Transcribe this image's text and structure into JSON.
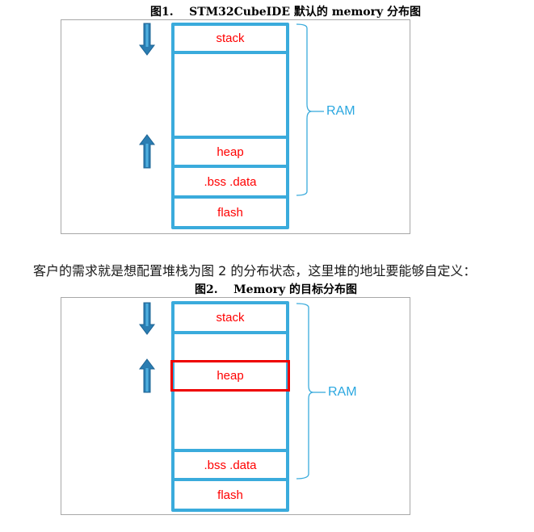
{
  "figure1": {
    "caption": "图1.    STM32CubeIDE 默认的 memory 分布图",
    "blocks": {
      "stack": "stack",
      "heap": "heap",
      "bss_data": ".bss .data",
      "flash": "flash"
    },
    "brace_label": "RAM",
    "arrows": [
      "down-arrow",
      "up-arrow"
    ]
  },
  "paragraph": "客户的需求就是想配置堆栈为图 2 的分布状态，这里堆的地址要能够自定义：",
  "figure2": {
    "caption": "图2.    Memory 的目标分布图",
    "blocks": {
      "stack": "stack",
      "heap": "heap",
      "bss_data": ".bss .data",
      "flash": "flash"
    },
    "brace_label": "RAM",
    "highlight_color": "#ee0000",
    "arrows": [
      "down-arrow",
      "up-arrow"
    ]
  },
  "colors": {
    "memory_border": "#3aabdc",
    "block_text": "#ff0000",
    "ram_label": "#2aa7e0",
    "arrow": "#2a7db2"
  }
}
